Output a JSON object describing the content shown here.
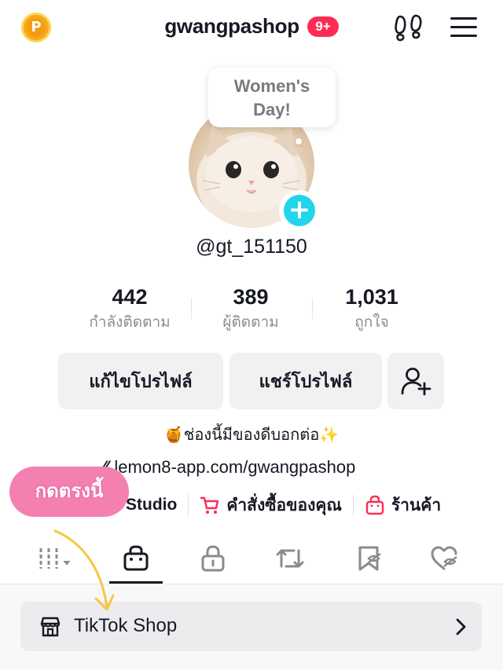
{
  "header": {
    "username": "gwangpashop",
    "badge": "9+"
  },
  "bubble": {
    "line1": "Women's",
    "line2": "Day!"
  },
  "profile": {
    "handle": "@gt_151150"
  },
  "stats": [
    {
      "value": "442",
      "label": "กำลังติดตาม"
    },
    {
      "value": "389",
      "label": "ผู้ติดตาม"
    },
    {
      "value": "1,031",
      "label": "ถูกใจ"
    }
  ],
  "buttons": {
    "edit_profile": "แก้ไขโปรไฟล์",
    "share_profile": "แชร์โปรไฟล์"
  },
  "bio": "🍯ช่องนี้มีของดีบอกต่อ✨",
  "link": "lemon8-app.com/gwangpashop",
  "tools": {
    "studio": "Studio",
    "orders": "คำสั่งซื้อของคุณ",
    "shop": "ร้านค้า"
  },
  "annotation": {
    "pill": "กดตรงนี้"
  },
  "shop_row": {
    "label": "TikTok Shop"
  },
  "colors": {
    "accent_red": "#fe2c55",
    "avatar_add": "#20d5ec",
    "annotation_pink": "#f47fb1",
    "arrow_yellow": "#f5c842"
  },
  "icons": {
    "coin": "coin-icon",
    "footprint": "footprint-icon",
    "menu": "hamburger-menu-icon",
    "add_friend": "add-friend-icon",
    "cart": "cart-icon",
    "bag": "shopping-bag-icon",
    "store": "store-icon",
    "chevron": "chevron-right-icon"
  }
}
